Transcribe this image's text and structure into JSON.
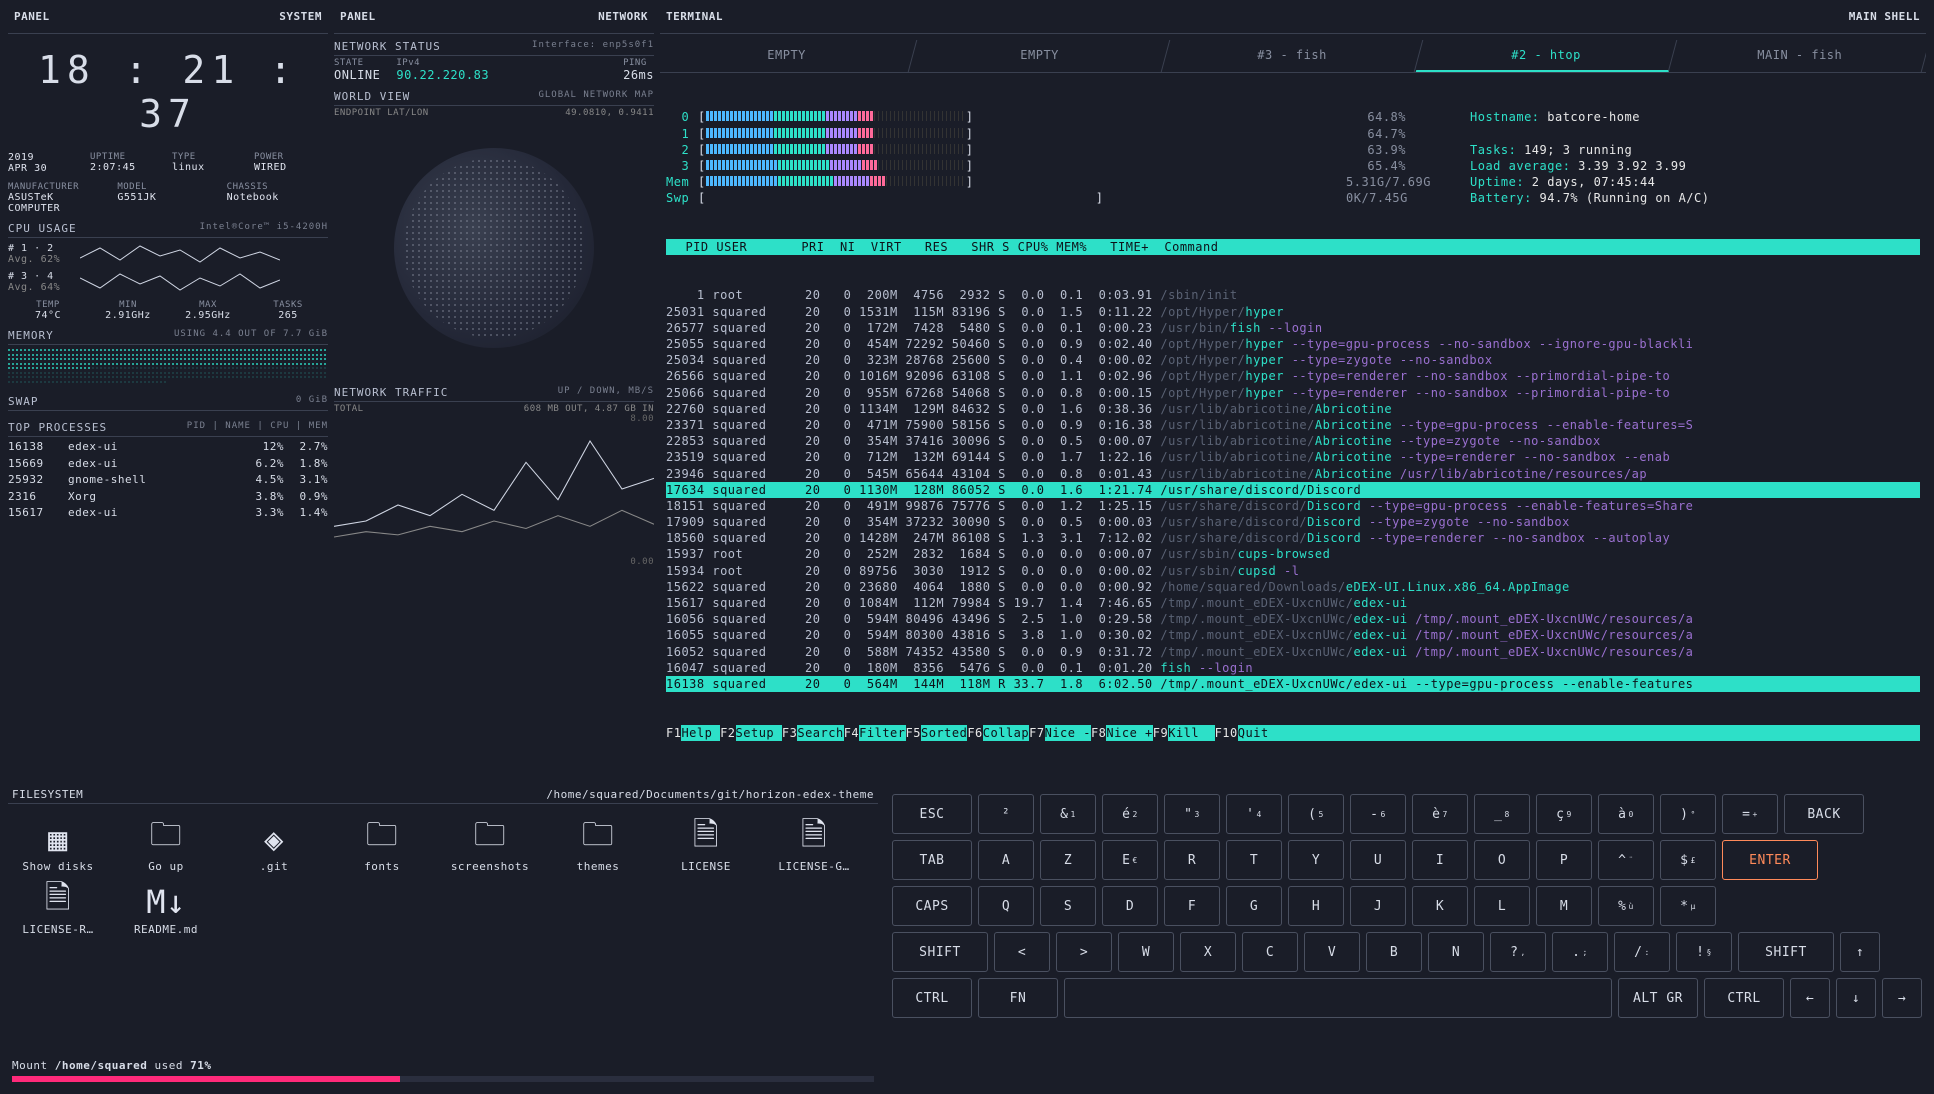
{
  "headers": {
    "panel1_l": "PANEL",
    "panel1_r": "SYSTEM",
    "panel2_l": "PANEL",
    "panel2_r": "NETWORK",
    "term_l": "TERMINAL",
    "term_r": "MAIN SHELL"
  },
  "clock": "18 : 21 : 37",
  "sys_date": {
    "year": "2019",
    "date": "APR 30",
    "uptime_lbl": "UPTIME",
    "uptime": "2:07:45",
    "type_lbl": "TYPE",
    "type": "linux",
    "power_lbl": "POWER",
    "power": "WIRED"
  },
  "sys_hw": {
    "mfr_lbl": "MANUFACTURER",
    "mfr": "ASUSTeK COMPUTER",
    "model_lbl": "MODEL",
    "model": "G551JK",
    "chassis_lbl": "CHASSIS",
    "chassis": "Notebook"
  },
  "cpu": {
    "title": "CPU USAGE",
    "model": "Intel®Core™ i5-4200H",
    "g1_lbl": "# 1 · 2",
    "g1_avg": "Avg. 62%",
    "g2_lbl": "# 3 · 4",
    "g2_avg": "Avg. 64%"
  },
  "cpu_stats": {
    "temp_lbl": "TEMP",
    "temp": "74°C",
    "min_lbl": "MIN",
    "min": "2.91GHz",
    "max_lbl": "MAX",
    "max": "2.95GHz",
    "tasks_lbl": "TASKS",
    "tasks": "265"
  },
  "mem": {
    "title": "MEMORY",
    "sub": "USING 4.4 OUT OF 7.7 GiB"
  },
  "swap": {
    "title": "SWAP",
    "val": "0 GiB"
  },
  "tproc": {
    "title": "TOP PROCESSES",
    "sub": "PID | NAME | CPU | MEM",
    "rows": [
      {
        "pid": "16138",
        "name": "edex-ui",
        "cpu": "12%",
        "mem": "2.7%"
      },
      {
        "pid": "15669",
        "name": "edex-ui",
        "cpu": "6.2%",
        "mem": "1.8%"
      },
      {
        "pid": "25932",
        "name": "gnome-shell",
        "cpu": "4.5%",
        "mem": "3.1%"
      },
      {
        "pid": "2316",
        "name": "Xorg",
        "cpu": "3.8%",
        "mem": "0.9%"
      },
      {
        "pid": "15617",
        "name": "edex-ui",
        "cpu": "3.3%",
        "mem": "1.4%"
      }
    ]
  },
  "net_status": {
    "title": "NETWORK STATUS",
    "iface_lbl": "Interface:",
    "iface": "enp5s0f1",
    "state_lbl": "STATE",
    "state": "ONLINE",
    "ipv4_lbl": "IPv4",
    "ipv4": "90.22.220.83",
    "ping_lbl": "PING",
    "ping": "26ms"
  },
  "world": {
    "title": "WORLD VIEW",
    "sub": "GLOBAL NETWORK MAP",
    "endpoint_lbl": "ENDPOINT LAT/LON",
    "endpoint": "49.0810, 0.9411"
  },
  "traffic": {
    "title": "NETWORK TRAFFIC",
    "sub": "UP / DOWN, MB/S",
    "total_lbl": "TOTAL",
    "total": "608 MB OUT, 4.87 GB IN",
    "ymax": "8.00",
    "ymin": "0.00"
  },
  "term_tabs": [
    "EMPTY",
    "EMPTY",
    "#3 - fish",
    "#2 - htop",
    "MAIN - fish"
  ],
  "term_active_idx": 3,
  "htop": {
    "cpus": [
      {
        "n": "0",
        "pct": "64.8%"
      },
      {
        "n": "1",
        "pct": "64.7%"
      },
      {
        "n": "2",
        "pct": "63.9%"
      },
      {
        "n": "3",
        "pct": "65.4%"
      }
    ],
    "mem_lbl": "Mem",
    "mem": "5.31G/7.69G",
    "swp_lbl": "Swp",
    "swp": "0K/7.45G",
    "hostname_lbl": "Hostname:",
    "hostname": "batcore-home",
    "tasks_lbl": "Tasks:",
    "tasks": "149; 3 running",
    "load_lbl": "Load average:",
    "load": "3.39 3.92 3.99",
    "uptime_lbl": "Uptime:",
    "uptime": "2 days, 07:45:44",
    "battery_lbl": "Battery:",
    "battery": "94.7% (Running on A/C)",
    "hdr": "  PID USER       PRI  NI  VIRT   RES   SHR S CPU% MEM%   TIME+  Command",
    "rows": [
      {
        "hl": false,
        "txt": "    1 root        20   0  200M  4756  2932 S  0.0  0.1  0:03.91 ",
        "path": "/sbin/init",
        "exe": "",
        "arg": ""
      },
      {
        "hl": false,
        "txt": "25031 squared     20   0 1531M  115M 83196 S  0.0  1.5  0:11.22 ",
        "path": "/opt/Hyper/",
        "exe": "hyper",
        "arg": ""
      },
      {
        "hl": false,
        "txt": "26577 squared     20   0  172M  7428  5480 S  0.0  0.1  0:00.23 ",
        "path": "/usr/bin/",
        "exe": "fish",
        "arg": " --login"
      },
      {
        "hl": false,
        "txt": "25055 squared     20   0  454M 72292 50460 S  0.0  0.9  0:02.40 ",
        "path": "/opt/Hyper/",
        "exe": "hyper",
        "arg": " --type=gpu-process --no-sandbox --ignore-gpu-blackli"
      },
      {
        "hl": false,
        "txt": "25034 squared     20   0  323M 28768 25600 S  0.0  0.4  0:00.02 ",
        "path": "/opt/Hyper/",
        "exe": "hyper",
        "arg": " --type=zygote --no-sandbox"
      },
      {
        "hl": false,
        "txt": "26566 squared     20   0 1016M 92096 63108 S  0.0  1.1  0:02.96 ",
        "path": "/opt/Hyper/",
        "exe": "hyper",
        "arg": " --type=renderer --no-sandbox --primordial-pipe-to"
      },
      {
        "hl": false,
        "txt": "25066 squared     20   0  955M 67268 54068 S  0.0  0.8  0:00.15 ",
        "path": "/opt/Hyper/",
        "exe": "hyper",
        "arg": " --type=renderer --no-sandbox --primordial-pipe-to"
      },
      {
        "hl": false,
        "txt": "22760 squared     20   0 1134M  129M 84632 S  0.0  1.6  0:38.36 ",
        "path": "/usr/lib/abricotine/",
        "exe": "Abricotine",
        "arg": ""
      },
      {
        "hl": false,
        "txt": "23371 squared     20   0  471M 75900 58156 S  0.0  0.9  0:16.38 ",
        "path": "/usr/lib/abricotine/",
        "exe": "Abricotine",
        "arg": " --type=gpu-process --enable-features=S"
      },
      {
        "hl": false,
        "txt": "22853 squared     20   0  354M 37416 30096 S  0.0  0.5  0:00.07 ",
        "path": "/usr/lib/abricotine/",
        "exe": "Abricotine",
        "arg": " --type=zygote --no-sandbox"
      },
      {
        "hl": false,
        "txt": "23519 squared     20   0  712M  132M 69144 S  0.0  1.7  1:22.16 ",
        "path": "/usr/lib/abricotine/",
        "exe": "Abricotine",
        "arg": " --type=renderer --no-sandbox --enab"
      },
      {
        "hl": false,
        "txt": "23946 squared     20   0  545M 65644 43104 S  0.0  0.8  0:01.43 ",
        "path": "/usr/lib/abricotine/",
        "exe": "Abricotine",
        "arg": " /usr/lib/abricotine/resources/ap"
      },
      {
        "hl": true,
        "txt": "17634 squared     20   0 1130M  128M 86052 S  0.0  1.6  1:21.74 ",
        "path": "/usr/share/discord/",
        "exe": "Discord",
        "arg": ""
      },
      {
        "hl": false,
        "txt": "18151 squared     20   0  491M 99876 75776 S  0.0  1.2  1:25.15 ",
        "path": "/usr/share/discord/",
        "exe": "Discord",
        "arg": " --type=gpu-process --enable-features=Share"
      },
      {
        "hl": false,
        "txt": "17909 squared     20   0  354M 37232 30090 S  0.0  0.5  0:00.03 ",
        "path": "/usr/share/discord/",
        "exe": "Discord",
        "arg": " --type=zygote --no-sandbox"
      },
      {
        "hl": false,
        "txt": "18560 squared     20   0 1428M  247M 86108 S  1.3  3.1  7:12.02 ",
        "path": "/usr/share/discord/",
        "exe": "Discord",
        "arg": " --type=renderer --no-sandbox --autoplay"
      },
      {
        "hl": false,
        "txt": "15937 root        20   0  252M  2832  1684 S  0.0  0.0  0:00.07 ",
        "path": "/usr/sbin/",
        "exe": "cups-browsed",
        "arg": ""
      },
      {
        "hl": false,
        "txt": "15934 root        20   0 89756  3030  1912 S  0.0  0.0  0:00.02 ",
        "path": "/usr/sbin/",
        "exe": "cupsd",
        "arg": " -l"
      },
      {
        "hl": false,
        "txt": "15622 squared     20   0 23680  4064  1880 S  0.0  0.0  0:00.92 ",
        "path": "/home/squared/Downloads/",
        "exe": "eDEX-UI.Linux.x86_64.AppImage",
        "arg": ""
      },
      {
        "hl": false,
        "txt": "15617 squared     20   0 1084M  112M 79984 S 19.7  1.4  7:46.65 ",
        "path": "/tmp/.mount_eDEX-UxcnUWc/",
        "exe": "edex-ui",
        "arg": ""
      },
      {
        "hl": false,
        "txt": "16056 squared     20   0  594M 80496 43496 S  2.5  1.0  0:29.58 ",
        "path": "/tmp/.mount_eDEX-UxcnUWc/",
        "exe": "edex-ui",
        "arg": " /tmp/.mount_eDEX-UxcnUWc/resources/a"
      },
      {
        "hl": false,
        "txt": "16055 squared     20   0  594M 80300 43816 S  3.8  1.0  0:30.02 ",
        "path": "/tmp/.mount_eDEX-UxcnUWc/",
        "exe": "edex-ui",
        "arg": " /tmp/.mount_eDEX-UxcnUWc/resources/a"
      },
      {
        "hl": false,
        "txt": "16052 squared     20   0  588M 74352 43580 S  0.0  0.9  0:31.72 ",
        "path": "/tmp/.mount_eDEX-UxcnUWc/",
        "exe": "edex-ui",
        "arg": " /tmp/.mount_eDEX-UxcnUWc/resources/a"
      },
      {
        "hl": false,
        "txt": "16047 squared     20   0  180M  8356  5476 S  0.0  0.1  0:01.20 ",
        "path": "",
        "exe": "fish",
        "arg": " --login"
      },
      {
        "hl": true,
        "txt": "16138 squared     20   0  564M  144M  118M R 33.7  1.8  6:02.50 ",
        "path": "/tmp/.mount_eDEX-UxcnUWc/",
        "exe": "edex-ui",
        "arg": " --type=gpu-process --enable-features"
      }
    ],
    "fkeys": [
      {
        "f": "F1",
        "l": "Help "
      },
      {
        "f": "F2",
        "l": "Setup "
      },
      {
        "f": "F3",
        "l": "Search"
      },
      {
        "f": "F4",
        "l": "Filter"
      },
      {
        "f": "F5",
        "l": "Sorted"
      },
      {
        "f": "F6",
        "l": "Collap"
      },
      {
        "f": "F7",
        "l": "Nice -"
      },
      {
        "f": "F8",
        "l": "Nice +"
      },
      {
        "f": "F9",
        "l": "Kill  "
      },
      {
        "f": "F10",
        "l": "Quit  "
      }
    ]
  },
  "fs": {
    "title": "FILESYSTEM",
    "path": "/home/squared/Documents/git/horizon-edex-theme",
    "items": [
      {
        "icon": "grid",
        "name": "Show disks"
      },
      {
        "icon": "folder",
        "name": "Go up"
      },
      {
        "icon": "git",
        "name": ".git"
      },
      {
        "icon": "folder",
        "name": "fonts"
      },
      {
        "icon": "folder",
        "name": "screenshots"
      },
      {
        "icon": "folder",
        "name": "themes"
      },
      {
        "icon": "file",
        "name": "LICENSE"
      },
      {
        "icon": "file",
        "name": "LICENSE-G…"
      },
      {
        "icon": "file",
        "name": "LICENSE-R…"
      },
      {
        "icon": "md",
        "name": "README.md"
      }
    ],
    "mount_prefix": "Mount ",
    "mount_path": "/home/squared",
    "mount_used_lbl": " used ",
    "mount_pct": "71%",
    "mount_fill": 45
  },
  "kb": {
    "row1": [
      "ESC",
      "²",
      "&",
      "é",
      "\"",
      "'",
      "(",
      "-",
      "è",
      "_",
      "ç",
      "à",
      ")",
      "=",
      "BACK"
    ],
    "row1_sub": [
      "",
      "",
      "1",
      "2",
      "3",
      "4",
      "5",
      "6",
      "7",
      "8",
      "9",
      "0",
      "°",
      "+",
      ""
    ],
    "row2": [
      "TAB",
      "A",
      "Z",
      "E",
      "R",
      "T",
      "Y",
      "U",
      "I",
      "O",
      "P",
      "^",
      "$",
      "ENTER"
    ],
    "row2_sub": [
      "",
      "",
      "",
      "€",
      "",
      "",
      "",
      "",
      "",
      "",
      "",
      "¨",
      "£",
      ""
    ],
    "row3": [
      "CAPS",
      "Q",
      "S",
      "D",
      "F",
      "G",
      "H",
      "J",
      "K",
      "L",
      "M",
      "%",
      "*"
    ],
    "row3_sub": [
      "",
      "",
      "",
      "",
      "",
      "",
      "",
      "",
      "",
      "",
      "",
      "ù",
      "µ"
    ],
    "row4": [
      "SHIFT",
      "<",
      ">",
      "W",
      "X",
      "C",
      "V",
      "B",
      "N",
      "?",
      ".",
      "/",
      "!",
      "SHIFT",
      "↑"
    ],
    "row4_sub": [
      "",
      "",
      "",
      "",
      "",
      "",
      "",
      "",
      "",
      ",",
      ";",
      ":",
      "§",
      "",
      ""
    ],
    "row5": [
      "CTRL",
      "FN",
      "",
      "ALT GR",
      "CTRL",
      "←",
      "↓",
      "→"
    ]
  }
}
